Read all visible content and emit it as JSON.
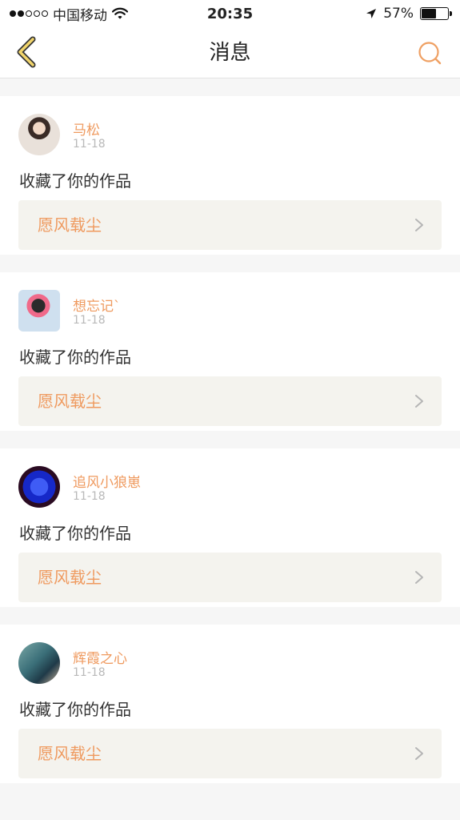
{
  "status_bar": {
    "carrier": "中国移动",
    "time": "20:35",
    "battery_percent": "57%",
    "battery_level": 0.57,
    "signal_bars_filled": 2,
    "signal_bars_total": 5
  },
  "nav": {
    "title": "消息",
    "accent_color": "#efa063"
  },
  "messages": [
    {
      "user": "马松",
      "date": "11-18",
      "action": "收藏了你的作品",
      "work": "愿风载尘"
    },
    {
      "user": "想忘记`",
      "date": "11-18",
      "action": "收藏了你的作品",
      "work": "愿风载尘"
    },
    {
      "user": "追风小狼崽",
      "date": "11-18",
      "action": "收藏了你的作品",
      "work": "愿风载尘"
    },
    {
      "user": "辉霞之心",
      "date": "11-18",
      "action": "收藏了你的作品",
      "work": "愿风载尘"
    }
  ]
}
